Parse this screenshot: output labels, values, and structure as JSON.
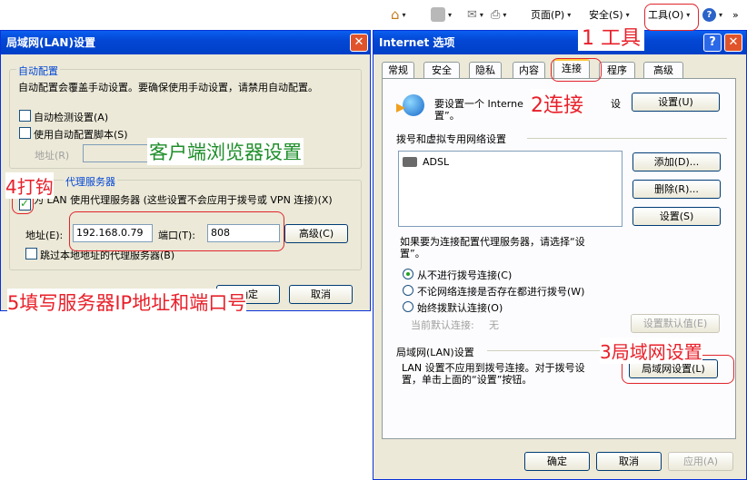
{
  "toolbar": {
    "page_menu": "页面(P)",
    "safety_menu": "安全(S)",
    "tools_menu": "工具(O)"
  },
  "lan_dialog": {
    "title": "局域网(LAN)设置",
    "auto_group_label": "自动配置",
    "auto_desc": "自动配置会覆盖手动设置。要确保使用手动设置，请禁用自动配置。",
    "auto_detect_label": "自动检测设置(A)",
    "auto_detect_checked": false,
    "use_script_label": "使用自动配置脚本(S)",
    "use_script_checked": false,
    "script_address_label": "地址(R)",
    "script_address_value": "",
    "proxy_group_label": "代理服务器",
    "use_proxy_label": "为 LAN 使用代理服务器 (这些设置不会应用于拨号或 VPN 连接)(X)",
    "use_proxy_checked": true,
    "address_label": "地址(E):",
    "address_value": "192.168.0.79",
    "port_label": "端口(T):",
    "port_value": "808",
    "advanced_button": "高级(C)",
    "bypass_label": "跳过本地地址的代理服务器(B)",
    "bypass_checked": false,
    "ok_button": "确定",
    "cancel_button": "取消"
  },
  "options_dialog": {
    "title": "Internet 选项",
    "tabs": [
      "常规",
      "安全",
      "隐私",
      "内容",
      "连接",
      "程序",
      "高级"
    ],
    "active_tab": "连接",
    "setup_text_1": "要设置一个 Interne",
    "setup_text_2": "设",
    "setup_text_3": "置”。",
    "setup_button": "设置(U)",
    "dialup_group_label": "拨号和虚拟专用网络设置",
    "connections": [
      "ADSL"
    ],
    "add_button": "添加(D)...",
    "remove_button": "删除(R)...",
    "settings_button": "设置(S)",
    "proxy_prompt": "如果要为连接配置代理服务器，请选择“设置”。",
    "radio_never": "从不进行拨号连接(C)",
    "radio_no_network": "不论网络连接是否存在都进行拨号(W)",
    "radio_always": "始终拨默认连接(O)",
    "selected_radio": "radio_never",
    "current_default_label": "当前默认连接:",
    "current_default_value": "无",
    "set_default_button": "设置默认值(E)",
    "lan_group_label": "局域网(LAN)设置",
    "lan_desc": "LAN 设置不应用到拨号连接。对于拨号设置，单击上面的“设置”按钮。",
    "lan_settings_button": "局域网设置(L)",
    "ok_button": "确定",
    "cancel_button": "取消",
    "apply_button": "应用(A)"
  },
  "annotations": {
    "step1": "1 工具",
    "step2": "2连接",
    "step3": "3局域网设置",
    "step4": "4打钩",
    "step5": "5填写服务器IP地址和端口号",
    "client_label": "客户端浏览器设置"
  },
  "colors": {
    "title_blue": "#0347d4",
    "annotation_red": "#e8202a",
    "annotation_green": "#1e8e2a",
    "dialog_face": "#ece9d8"
  }
}
